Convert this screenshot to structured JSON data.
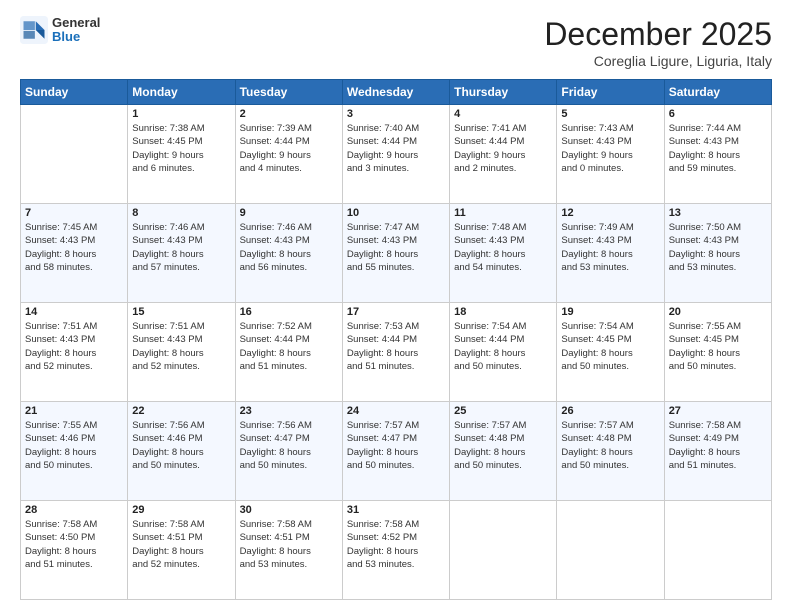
{
  "header": {
    "logo_general": "General",
    "logo_blue": "Blue",
    "month": "December 2025",
    "location": "Coreglia Ligure, Liguria, Italy"
  },
  "days_of_week": [
    "Sunday",
    "Monday",
    "Tuesday",
    "Wednesday",
    "Thursday",
    "Friday",
    "Saturday"
  ],
  "weeks": [
    [
      {
        "day": "",
        "info": []
      },
      {
        "day": "1",
        "info": [
          "Sunrise: 7:38 AM",
          "Sunset: 4:45 PM",
          "Daylight: 9 hours",
          "and 6 minutes."
        ]
      },
      {
        "day": "2",
        "info": [
          "Sunrise: 7:39 AM",
          "Sunset: 4:44 PM",
          "Daylight: 9 hours",
          "and 4 minutes."
        ]
      },
      {
        "day": "3",
        "info": [
          "Sunrise: 7:40 AM",
          "Sunset: 4:44 PM",
          "Daylight: 9 hours",
          "and 3 minutes."
        ]
      },
      {
        "day": "4",
        "info": [
          "Sunrise: 7:41 AM",
          "Sunset: 4:44 PM",
          "Daylight: 9 hours",
          "and 2 minutes."
        ]
      },
      {
        "day": "5",
        "info": [
          "Sunrise: 7:43 AM",
          "Sunset: 4:43 PM",
          "Daylight: 9 hours",
          "and 0 minutes."
        ]
      },
      {
        "day": "6",
        "info": [
          "Sunrise: 7:44 AM",
          "Sunset: 4:43 PM",
          "Daylight: 8 hours",
          "and 59 minutes."
        ]
      }
    ],
    [
      {
        "day": "7",
        "info": [
          "Sunrise: 7:45 AM",
          "Sunset: 4:43 PM",
          "Daylight: 8 hours",
          "and 58 minutes."
        ]
      },
      {
        "day": "8",
        "info": [
          "Sunrise: 7:46 AM",
          "Sunset: 4:43 PM",
          "Daylight: 8 hours",
          "and 57 minutes."
        ]
      },
      {
        "day": "9",
        "info": [
          "Sunrise: 7:46 AM",
          "Sunset: 4:43 PM",
          "Daylight: 8 hours",
          "and 56 minutes."
        ]
      },
      {
        "day": "10",
        "info": [
          "Sunrise: 7:47 AM",
          "Sunset: 4:43 PM",
          "Daylight: 8 hours",
          "and 55 minutes."
        ]
      },
      {
        "day": "11",
        "info": [
          "Sunrise: 7:48 AM",
          "Sunset: 4:43 PM",
          "Daylight: 8 hours",
          "and 54 minutes."
        ]
      },
      {
        "day": "12",
        "info": [
          "Sunrise: 7:49 AM",
          "Sunset: 4:43 PM",
          "Daylight: 8 hours",
          "and 53 minutes."
        ]
      },
      {
        "day": "13",
        "info": [
          "Sunrise: 7:50 AM",
          "Sunset: 4:43 PM",
          "Daylight: 8 hours",
          "and 53 minutes."
        ]
      }
    ],
    [
      {
        "day": "14",
        "info": [
          "Sunrise: 7:51 AM",
          "Sunset: 4:43 PM",
          "Daylight: 8 hours",
          "and 52 minutes."
        ]
      },
      {
        "day": "15",
        "info": [
          "Sunrise: 7:51 AM",
          "Sunset: 4:43 PM",
          "Daylight: 8 hours",
          "and 52 minutes."
        ]
      },
      {
        "day": "16",
        "info": [
          "Sunrise: 7:52 AM",
          "Sunset: 4:44 PM",
          "Daylight: 8 hours",
          "and 51 minutes."
        ]
      },
      {
        "day": "17",
        "info": [
          "Sunrise: 7:53 AM",
          "Sunset: 4:44 PM",
          "Daylight: 8 hours",
          "and 51 minutes."
        ]
      },
      {
        "day": "18",
        "info": [
          "Sunrise: 7:54 AM",
          "Sunset: 4:44 PM",
          "Daylight: 8 hours",
          "and 50 minutes."
        ]
      },
      {
        "day": "19",
        "info": [
          "Sunrise: 7:54 AM",
          "Sunset: 4:45 PM",
          "Daylight: 8 hours",
          "and 50 minutes."
        ]
      },
      {
        "day": "20",
        "info": [
          "Sunrise: 7:55 AM",
          "Sunset: 4:45 PM",
          "Daylight: 8 hours",
          "and 50 minutes."
        ]
      }
    ],
    [
      {
        "day": "21",
        "info": [
          "Sunrise: 7:55 AM",
          "Sunset: 4:46 PM",
          "Daylight: 8 hours",
          "and 50 minutes."
        ]
      },
      {
        "day": "22",
        "info": [
          "Sunrise: 7:56 AM",
          "Sunset: 4:46 PM",
          "Daylight: 8 hours",
          "and 50 minutes."
        ]
      },
      {
        "day": "23",
        "info": [
          "Sunrise: 7:56 AM",
          "Sunset: 4:47 PM",
          "Daylight: 8 hours",
          "and 50 minutes."
        ]
      },
      {
        "day": "24",
        "info": [
          "Sunrise: 7:57 AM",
          "Sunset: 4:47 PM",
          "Daylight: 8 hours",
          "and 50 minutes."
        ]
      },
      {
        "day": "25",
        "info": [
          "Sunrise: 7:57 AM",
          "Sunset: 4:48 PM",
          "Daylight: 8 hours",
          "and 50 minutes."
        ]
      },
      {
        "day": "26",
        "info": [
          "Sunrise: 7:57 AM",
          "Sunset: 4:48 PM",
          "Daylight: 8 hours",
          "and 50 minutes."
        ]
      },
      {
        "day": "27",
        "info": [
          "Sunrise: 7:58 AM",
          "Sunset: 4:49 PM",
          "Daylight: 8 hours",
          "and 51 minutes."
        ]
      }
    ],
    [
      {
        "day": "28",
        "info": [
          "Sunrise: 7:58 AM",
          "Sunset: 4:50 PM",
          "Daylight: 8 hours",
          "and 51 minutes."
        ]
      },
      {
        "day": "29",
        "info": [
          "Sunrise: 7:58 AM",
          "Sunset: 4:51 PM",
          "Daylight: 8 hours",
          "and 52 minutes."
        ]
      },
      {
        "day": "30",
        "info": [
          "Sunrise: 7:58 AM",
          "Sunset: 4:51 PM",
          "Daylight: 8 hours",
          "and 53 minutes."
        ]
      },
      {
        "day": "31",
        "info": [
          "Sunrise: 7:58 AM",
          "Sunset: 4:52 PM",
          "Daylight: 8 hours",
          "and 53 minutes."
        ]
      },
      {
        "day": "",
        "info": []
      },
      {
        "day": "",
        "info": []
      },
      {
        "day": "",
        "info": []
      }
    ]
  ]
}
